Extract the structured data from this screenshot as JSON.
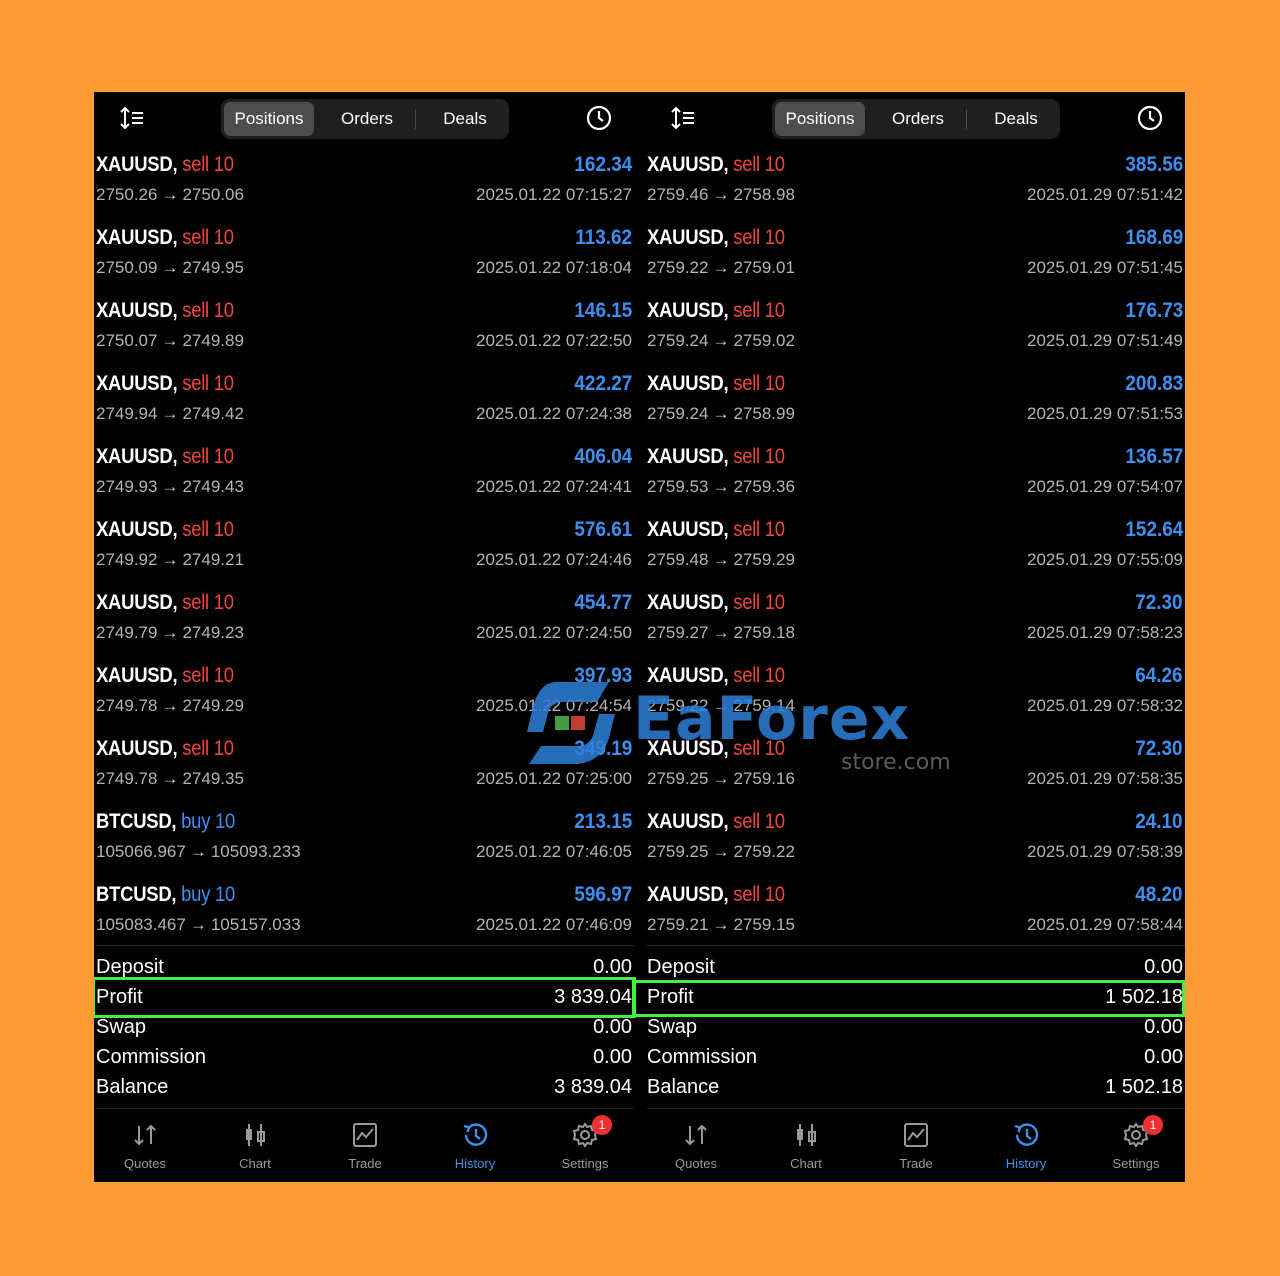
{
  "colors": {
    "background": "#fd9b35",
    "panel": "#000000",
    "sell": "#f0453d",
    "buy": "#3d8ff0",
    "profit": "#3d8ff0",
    "highlight": "#3ff23f"
  },
  "watermark": {
    "brand": "EaForex",
    "sub": "store.com"
  },
  "panels": [
    {
      "segments": [
        "Positions",
        "Orders",
        "Deals"
      ],
      "active_segment": "Positions",
      "rows": [
        {
          "symbol": "XAUUSD,",
          "side": "sell 10",
          "type": "sell",
          "profit": "162.34",
          "prices": {
            "open": "2750.26",
            "arrow": "→",
            "close": "2750.06"
          },
          "time": "2025.01.22 07:15:27"
        },
        {
          "symbol": "XAUUSD,",
          "side": "sell 10",
          "type": "sell",
          "profit": "113.62",
          "prices": {
            "open": "2750.09",
            "arrow": "→",
            "close": "2749.95"
          },
          "time": "2025.01.22 07:18:04"
        },
        {
          "symbol": "XAUUSD,",
          "side": "sell 10",
          "type": "sell",
          "profit": "146.15",
          "prices": {
            "open": "2750.07",
            "arrow": "→",
            "close": "2749.89"
          },
          "time": "2025.01.22 07:22:50"
        },
        {
          "symbol": "XAUUSD,",
          "side": "sell 10",
          "type": "sell",
          "profit": "422.27",
          "prices": {
            "open": "2749.94",
            "arrow": "→",
            "close": "2749.42"
          },
          "time": "2025.01.22 07:24:38"
        },
        {
          "symbol": "XAUUSD,",
          "side": "sell 10",
          "type": "sell",
          "profit": "406.04",
          "prices": {
            "open": "2749.93",
            "arrow": "→",
            "close": "2749.43"
          },
          "time": "2025.01.22 07:24:41"
        },
        {
          "symbol": "XAUUSD,",
          "side": "sell 10",
          "type": "sell",
          "profit": "576.61",
          "prices": {
            "open": "2749.92",
            "arrow": "→",
            "close": "2749.21"
          },
          "time": "2025.01.22 07:24:46"
        },
        {
          "symbol": "XAUUSD,",
          "side": "sell 10",
          "type": "sell",
          "profit": "454.77",
          "prices": {
            "open": "2749.79",
            "arrow": "→",
            "close": "2749.23"
          },
          "time": "2025.01.22 07:24:50"
        },
        {
          "symbol": "XAUUSD,",
          "side": "sell 10",
          "type": "sell",
          "profit": "397.93",
          "prices": {
            "open": "2749.78",
            "arrow": "→",
            "close": "2749.29"
          },
          "time": "2025.01.22 07:24:54"
        },
        {
          "symbol": "XAUUSD,",
          "side": "sell 10",
          "type": "sell",
          "profit": "349.19",
          "prices": {
            "open": "2749.78",
            "arrow": "→",
            "close": "2749.35"
          },
          "time": "2025.01.22 07:25:00"
        },
        {
          "symbol": "BTCUSD,",
          "side": "buy 10",
          "type": "buy",
          "profit": "213.15",
          "prices": {
            "open": "105066.967",
            "arrow": "→",
            "close": "105093.233"
          },
          "time": "2025.01.22 07:46:05"
        },
        {
          "symbol": "BTCUSD,",
          "side": "buy 10",
          "type": "buy",
          "profit": "596.97",
          "prices": {
            "open": "105083.467",
            "arrow": "→",
            "close": "105157.033"
          },
          "time": "2025.01.22 07:46:09"
        }
      ],
      "summary": [
        {
          "label": "Deposit",
          "value": "0.00"
        },
        {
          "label": "Profit",
          "value": "3 839.04"
        },
        {
          "label": "Swap",
          "value": "0.00"
        },
        {
          "label": "Commission",
          "value": "0.00"
        },
        {
          "label": "Balance",
          "value": "3 839.04"
        }
      ],
      "tabs": [
        {
          "label": "Quotes",
          "icon": "quotes-icon"
        },
        {
          "label": "Chart",
          "icon": "chart-icon"
        },
        {
          "label": "Trade",
          "icon": "trade-icon"
        },
        {
          "label": "History",
          "icon": "history-icon",
          "active": true
        },
        {
          "label": "Settings",
          "icon": "settings-icon",
          "badge": "1"
        }
      ]
    },
    {
      "segments": [
        "Positions",
        "Orders",
        "Deals"
      ],
      "active_segment": "Positions",
      "rows": [
        {
          "symbol": "XAUUSD,",
          "side": "sell 10",
          "type": "sell",
          "profit": "385.56",
          "prices": {
            "open": "2759.46",
            "arrow": "→",
            "close": "2758.98"
          },
          "time": "2025.01.29 07:51:42"
        },
        {
          "symbol": "XAUUSD,",
          "side": "sell 10",
          "type": "sell",
          "profit": "168.69",
          "prices": {
            "open": "2759.22",
            "arrow": "→",
            "close": "2759.01"
          },
          "time": "2025.01.29 07:51:45"
        },
        {
          "symbol": "XAUUSD,",
          "side": "sell 10",
          "type": "sell",
          "profit": "176.73",
          "prices": {
            "open": "2759.24",
            "arrow": "→",
            "close": "2759.02"
          },
          "time": "2025.01.29 07:51:49"
        },
        {
          "symbol": "XAUUSD,",
          "side": "sell 10",
          "type": "sell",
          "profit": "200.83",
          "prices": {
            "open": "2759.24",
            "arrow": "→",
            "close": "2758.99"
          },
          "time": "2025.01.29 07:51:53"
        },
        {
          "symbol": "XAUUSD,",
          "side": "sell 10",
          "type": "sell",
          "profit": "136.57",
          "prices": {
            "open": "2759.53",
            "arrow": "→",
            "close": "2759.36"
          },
          "time": "2025.01.29 07:54:07"
        },
        {
          "symbol": "XAUUSD,",
          "side": "sell 10",
          "type": "sell",
          "profit": "152.64",
          "prices": {
            "open": "2759.48",
            "arrow": "→",
            "close": "2759.29"
          },
          "time": "2025.01.29 07:55:09"
        },
        {
          "symbol": "XAUUSD,",
          "side": "sell 10",
          "type": "sell",
          "profit": "72.30",
          "prices": {
            "open": "2759.27",
            "arrow": "→",
            "close": "2759.18"
          },
          "time": "2025.01.29 07:58:23"
        },
        {
          "symbol": "XAUUSD,",
          "side": "sell 10",
          "type": "sell",
          "profit": "64.26",
          "prices": {
            "open": "2759.22",
            "arrow": "→",
            "close": "2759.14"
          },
          "time": "2025.01.29 07:58:32"
        },
        {
          "symbol": "XAUUSD,",
          "side": "sell 10",
          "type": "sell",
          "profit": "72.30",
          "prices": {
            "open": "2759.25",
            "arrow": "→",
            "close": "2759.16"
          },
          "time": "2025.01.29 07:58:35"
        },
        {
          "symbol": "XAUUSD,",
          "side": "sell 10",
          "type": "sell",
          "profit": "24.10",
          "prices": {
            "open": "2759.25",
            "arrow": "→",
            "close": "2759.22"
          },
          "time": "2025.01.29 07:58:39"
        },
        {
          "symbol": "XAUUSD,",
          "side": "sell 10",
          "type": "sell",
          "profit": "48.20",
          "prices": {
            "open": "2759.21",
            "arrow": "→",
            "close": "2759.15"
          },
          "time": "2025.01.29 07:58:44"
        }
      ],
      "summary": [
        {
          "label": "Deposit",
          "value": "0.00"
        },
        {
          "label": "Profit",
          "value": "1 502.18"
        },
        {
          "label": "Swap",
          "value": "0.00"
        },
        {
          "label": "Commission",
          "value": "0.00"
        },
        {
          "label": "Balance",
          "value": "1 502.18"
        }
      ],
      "tabs": [
        {
          "label": "Quotes",
          "icon": "quotes-icon"
        },
        {
          "label": "Chart",
          "icon": "chart-icon"
        },
        {
          "label": "Trade",
          "icon": "trade-icon"
        },
        {
          "label": "History",
          "icon": "history-icon",
          "active": true
        },
        {
          "label": "Settings",
          "icon": "settings-icon",
          "badge": "1"
        }
      ]
    }
  ]
}
